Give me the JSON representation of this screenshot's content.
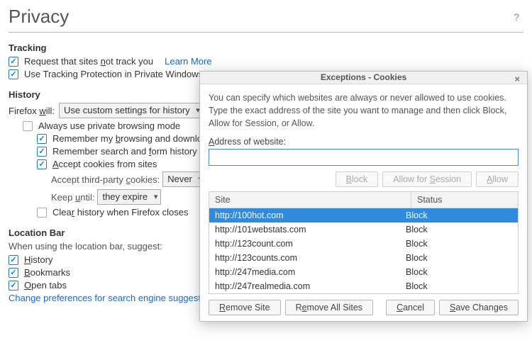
{
  "page": {
    "title": "Privacy",
    "help_tooltip": "?"
  },
  "tracking": {
    "heading": "Tracking",
    "dnt_label": "Request that sites not track you",
    "dnt_access": "n",
    "tp_label": "Use Tracking Protection in Private Windows",
    "learn_more": "Learn More"
  },
  "history": {
    "heading": "History",
    "will_label": "Firefox will:",
    "will_access": "w",
    "will_value": "Use custom settings for history",
    "always_private": "Always use private browsing mode",
    "remember_history": "Remember my browsing and download history",
    "remember_history_access": "b",
    "remember_search": "Remember search and form history",
    "remember_search_access": "f",
    "accept_cookies": "Accept cookies from sites",
    "accept_cookies_access": "A",
    "third_party_label": "Accept third-party cookies:",
    "third_party_access": "c",
    "third_party_value": "Never",
    "keep_until_label": "Keep until:",
    "keep_until_access": "u",
    "keep_until_value": "they expire",
    "clear_on_close": "Clear history when Firefox closes",
    "clear_on_close_access": "r"
  },
  "locbar": {
    "heading": "Location Bar",
    "intro": "When using the location bar, suggest:",
    "hist": "History",
    "hist_access": "H",
    "bm": "Bookmarks",
    "bm_access": "B",
    "tabs": "Open tabs",
    "tabs_access": "O",
    "change_engine": "Change preferences for search engine suggestions"
  },
  "dialog": {
    "title": "Exceptions - Cookies",
    "close": "×",
    "desc": "You can specify which websites are always or never allowed to use cookies. Type the exact address of the site you want to manage and then click Block, Allow for Session, or Allow.",
    "addr_label": "Address of website:",
    "addr_access": "A",
    "addr_value": "",
    "btn_block": "Block",
    "btn_block_access": "B",
    "btn_session": "Allow for Session",
    "btn_session_access": "S",
    "btn_allow": "Allow",
    "btn_allow_access": "A",
    "col_site": "Site",
    "col_status": "Status",
    "rows": [
      {
        "site": "http://100hot.com",
        "status": "Block",
        "selected": true
      },
      {
        "site": "http://101webstats.com",
        "status": "Block",
        "selected": false
      },
      {
        "site": "http://123count.com",
        "status": "Block",
        "selected": false
      },
      {
        "site": "http://123counts.com",
        "status": "Block",
        "selected": false
      },
      {
        "site": "http://247media.com",
        "status": "Block",
        "selected": false
      },
      {
        "site": "http://247realmedia.com",
        "status": "Block",
        "selected": false
      }
    ],
    "remove_site": "Remove Site",
    "remove_site_access": "R",
    "remove_all": "Remove All Sites",
    "remove_all_access": "e",
    "cancel": "Cancel",
    "cancel_access": "C",
    "save": "Save Changes",
    "save_access": "S"
  }
}
